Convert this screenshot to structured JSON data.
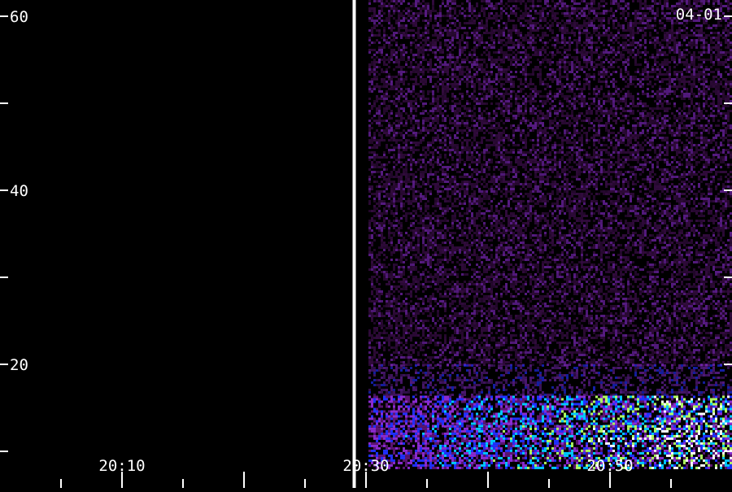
{
  "chart_data": {
    "type": "heatmap",
    "title": "",
    "xlabel": "",
    "ylabel": "",
    "date_label": "04-01",
    "x_tick_labels": [
      "20:10",
      "20:30",
      "20:50"
    ],
    "x_major_ticks": [
      "20:00",
      "20:10",
      "20:20",
      "20:30",
      "20:40",
      "20:50",
      "21:00"
    ],
    "x_minor_ticks": [
      "20:05",
      "20:15",
      "20:25",
      "20:35",
      "20:45",
      "20:55"
    ],
    "xlim": [
      "20:00",
      "21:00"
    ],
    "y_tick_labels": [
      60,
      40,
      20
    ],
    "y_ticks": [
      60,
      50,
      40,
      30,
      20,
      10
    ],
    "ylim": [
      8,
      62
    ],
    "marker_time": "20:29",
    "data_start_time": "20:30",
    "colormap": [
      "#000000",
      "#5a1470",
      "#8a2bd0",
      "#2030ff",
      "#00c8ff",
      "#b0ff60",
      "#ffffff"
    ],
    "bands": [
      {
        "f_low": 20,
        "f_high": 62,
        "intensity": 0.28,
        "note": "faint diffuse"
      },
      {
        "f_low": 16.4,
        "f_high": 20,
        "intensity": 0.35
      },
      {
        "f_low": 13,
        "f_high": 16.4,
        "intensity": 0.85
      },
      {
        "f_low": 8,
        "f_high": 13,
        "intensity": 0.95
      }
    ]
  }
}
